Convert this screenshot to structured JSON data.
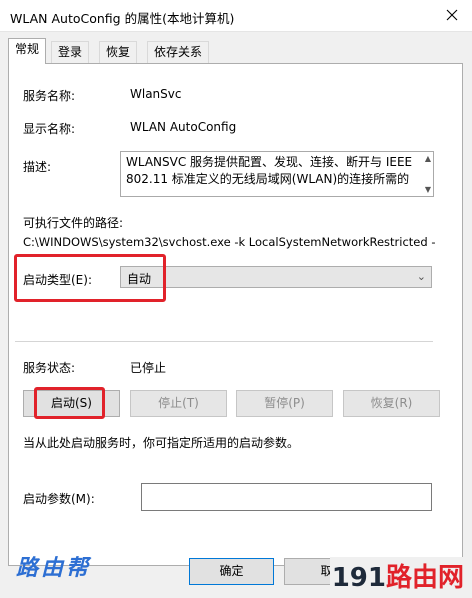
{
  "window": {
    "title": "WLAN AutoConfig 的属性(本地计算机)"
  },
  "tabs": [
    "常规",
    "登录",
    "恢复",
    "依存关系"
  ],
  "general": {
    "service_name_label": "服务名称:",
    "service_name": "WlanSvc",
    "display_name_label": "显示名称:",
    "display_name": "WLAN AutoConfig",
    "description_label": "描述:",
    "description_line1": "WLANSVC 服务提供配置、发现、连接、断开与 IEEE",
    "description_line2": "802.11 标准定义的无线局域网(WLAN)的连接所需的",
    "exe_path_label": "可执行文件的路径:",
    "exe_path": "C:\\WINDOWS\\system32\\svchost.exe -k LocalSystemNetworkRestricted -",
    "startup_type_label": "启动类型(E):",
    "startup_type_value": "自动",
    "status_label": "服务状态:",
    "status_value": "已停止",
    "buttons": {
      "start": "启动(S)",
      "stop": "停止(T)",
      "pause": "暂停(P)",
      "resume": "恢复(R)"
    },
    "hint": "当从此处启动服务时，你可指定所适用的启动参数。",
    "start_params_label": "启动参数(M):",
    "start_params_value": ""
  },
  "footer": {
    "ok": "确定",
    "cancel": "取"
  },
  "watermarks": {
    "left": "路由帮",
    "right_num": "191",
    "right_text": "路由网"
  },
  "colors": {
    "highlight": "#e1222a",
    "accent": "#0078d7"
  }
}
